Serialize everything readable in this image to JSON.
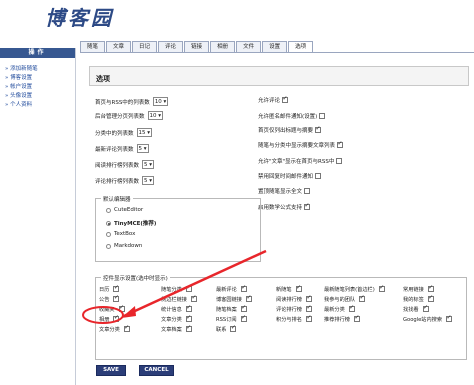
{
  "logo": "博客园",
  "tabs": [
    "随笔",
    "文章",
    "日记",
    "评论",
    "链接",
    "相册",
    "文件",
    "设置",
    "选项"
  ],
  "sidebar": {
    "title": "操作",
    "items": [
      "» 添加新随笔",
      "» 博客设置",
      "» 帐户设置",
      "» 头像设置",
      "» 个人资料"
    ]
  },
  "page_title": "选项",
  "left_rows": [
    {
      "label": "首页与RSS中的列表数",
      "value": "10"
    },
    {
      "label": "后台管理分页列表数",
      "value": "10"
    },
    {
      "label": "分类中的列表数",
      "value": "15"
    },
    {
      "label": "最新评论列表数",
      "value": "5"
    },
    {
      "label": "阅读排行榜列表数",
      "value": "5"
    },
    {
      "label": "评论排行榜列表数",
      "value": "5"
    }
  ],
  "right_rows": [
    {
      "label": "允许评论",
      "checked": true
    },
    {
      "label": "允许匿名邮件通知(设置)",
      "checked": false
    },
    {
      "label": "首页仅列出标题与摘要",
      "checked": true
    },
    {
      "label": "随笔与分类中显示摘要文章列表",
      "checked": true
    },
    {
      "label": "允许\"文章\"显示在首页与RSS中",
      "checked": false
    },
    {
      "label": "禁用回复时间邮件通知",
      "checked": false
    },
    {
      "label": "置顶随笔显示全文",
      "checked": false
    },
    {
      "label": "启用数学公式支持",
      "checked": true
    }
  ],
  "editor": {
    "legend": "默认编辑器",
    "options": [
      {
        "label": "CuteEditor",
        "selected": false,
        "bold": false
      },
      {
        "label": "TinyMCE(推荐)",
        "selected": true,
        "bold": true
      },
      {
        "label": "TextBox",
        "selected": false,
        "bold": false
      },
      {
        "label": "Markdown",
        "selected": false,
        "bold": false
      }
    ]
  },
  "toggles": {
    "legend": "控件显示设置(选中时显示)",
    "grid": [
      [
        {
          "l": "日历",
          "c": true
        },
        {
          "l": "随笔分类",
          "c": true
        },
        {
          "l": "最新评论",
          "c": true
        },
        {
          "l": "新随笔",
          "c": true
        },
        {
          "l": "最新随笔列表(首边栏)",
          "c": true
        },
        {
          "l": "常用链接",
          "c": true
        }
      ],
      [
        {
          "l": "公告",
          "c": true
        },
        {
          "l": "侧边栏链接",
          "c": true
        },
        {
          "l": "博客园链接",
          "c": true
        },
        {
          "l": "阅读排行榜",
          "c": true
        },
        {
          "l": "我参与的团队",
          "c": true
        },
        {
          "l": "我的标签",
          "c": true
        }
      ],
      [
        {
          "l": "收藏夹",
          "c": true
        },
        {
          "l": "统计信息",
          "c": true
        },
        {
          "l": "随笔档案",
          "c": true
        },
        {
          "l": "评论排行榜",
          "c": true
        },
        {
          "l": "最新分类",
          "c": true
        },
        {
          "l": "找找看",
          "c": true
        }
      ],
      [
        {
          "l": "相册",
          "c": true
        },
        {
          "l": "文章分类",
          "c": true
        },
        {
          "l": "RSS订阅",
          "c": true
        },
        {
          "l": "积分与排名",
          "c": true
        },
        {
          "l": "推荐排行榜",
          "c": true
        },
        {
          "l": "Google站内搜索",
          "c": true
        }
      ],
      [
        {
          "l": "文章分类",
          "c": true
        },
        {
          "l": "文章档案",
          "c": true
        },
        {
          "l": "联系",
          "c": true
        }
      ]
    ]
  },
  "buttons": {
    "save": "SAVE",
    "cancel": "CANCEL"
  },
  "colors": {
    "accent": "#375891",
    "annotation": "#e8262b",
    "link": "#1f4a9c"
  }
}
